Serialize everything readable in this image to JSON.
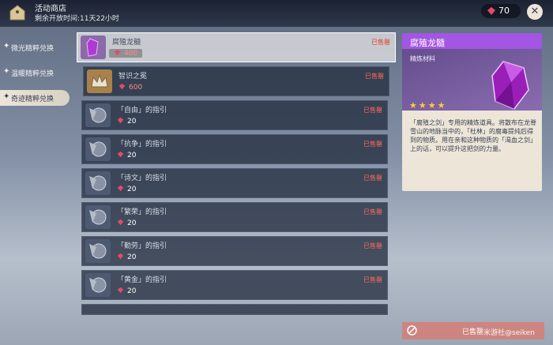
{
  "header": {
    "title": "活动商店",
    "timer": "剩余开放时间:11天22小时",
    "currency_amount": "70",
    "close_symbol": "✕"
  },
  "tabs": [
    {
      "label": "微光精粹兑换",
      "active": false
    },
    {
      "label": "温暖精粹兑换",
      "active": false
    },
    {
      "label": "奇迹精粹兑换",
      "active": true
    }
  ],
  "items": [
    {
      "name": "腐殖龙髓",
      "price": "400",
      "status": "已售罄",
      "selected": true,
      "icon": "purple-crystal"
    },
    {
      "name": "智识之冕",
      "price": "600",
      "status": "已售罄",
      "selected": false,
      "icon": "crown"
    },
    {
      "name": "「自由」的指引",
      "price": "20",
      "status": "已售罄",
      "selected": false,
      "icon": "talent-book"
    },
    {
      "name": "「抗争」的指引",
      "price": "20",
      "status": "已售罄",
      "selected": false,
      "icon": "talent-book"
    },
    {
      "name": "「诗文」的指引",
      "price": "20",
      "status": "已售罄",
      "selected": false,
      "icon": "talent-book"
    },
    {
      "name": "「繁荣」的指引",
      "price": "20",
      "status": "已售罄",
      "selected": false,
      "icon": "talent-book"
    },
    {
      "name": "「勤劳」的指引",
      "price": "20",
      "status": "已售罄",
      "selected": false,
      "icon": "talent-book"
    },
    {
      "name": "「黄金」的指引",
      "price": "20",
      "status": "已售罄",
      "selected": false,
      "icon": "talent-book"
    }
  ],
  "detail": {
    "title": "腐殖龙髓",
    "type": "精炼材料",
    "stars": "★★★★",
    "description": "「腐殖之剑」专用的精炼道具。将散布在龙脊雪山的地脉当中的，「杜林」的腐毒提纯后得到的物质。用在亲和这种物质的「渴血之剑」上的话，可以提升这把剑的力量。"
  },
  "bottom": {
    "status_label": "已售罄",
    "watermark": "米游社@seiken"
  },
  "colors": {
    "accent_purple": "#a256e1",
    "sold_red": "#ff6a5a",
    "panel_bg": "#ece5d8"
  }
}
